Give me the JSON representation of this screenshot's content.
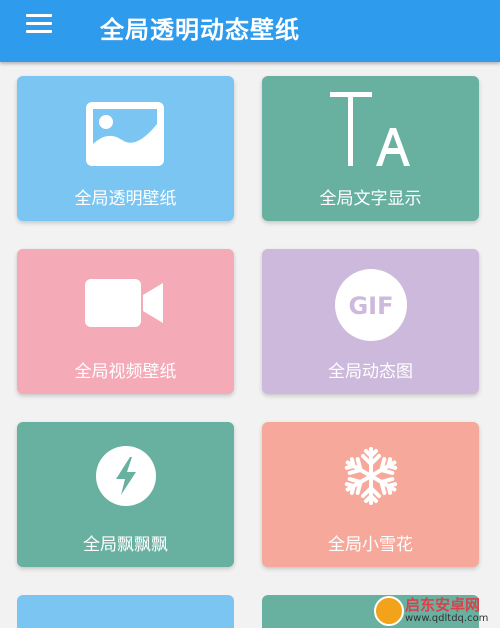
{
  "app": {
    "title": "全局透明动态壁纸",
    "primary_color": "#2f9bec"
  },
  "tiles": [
    {
      "label": "全局透明壁纸",
      "color": "#7ac5f2",
      "icon": "image-icon"
    },
    {
      "label": "全局文字显示",
      "color": "#68b1a0",
      "icon": "text-format-icon",
      "icon_text": "TA"
    },
    {
      "label": "全局视频壁纸",
      "color": "#f5aab7",
      "icon": "video-camera-icon"
    },
    {
      "label": "全局动态图",
      "color": "#ccb9db",
      "icon": "gif-icon",
      "icon_text": "GIF"
    },
    {
      "label": "全局飘飘飘",
      "color": "#68b1a0",
      "icon": "lightning-icon"
    },
    {
      "label": "全局小雪花",
      "color": "#f6a99b",
      "icon": "snowflake-icon"
    }
  ],
  "watermark": {
    "text": "启东安卓网",
    "url": "www.qdltdq.com"
  }
}
